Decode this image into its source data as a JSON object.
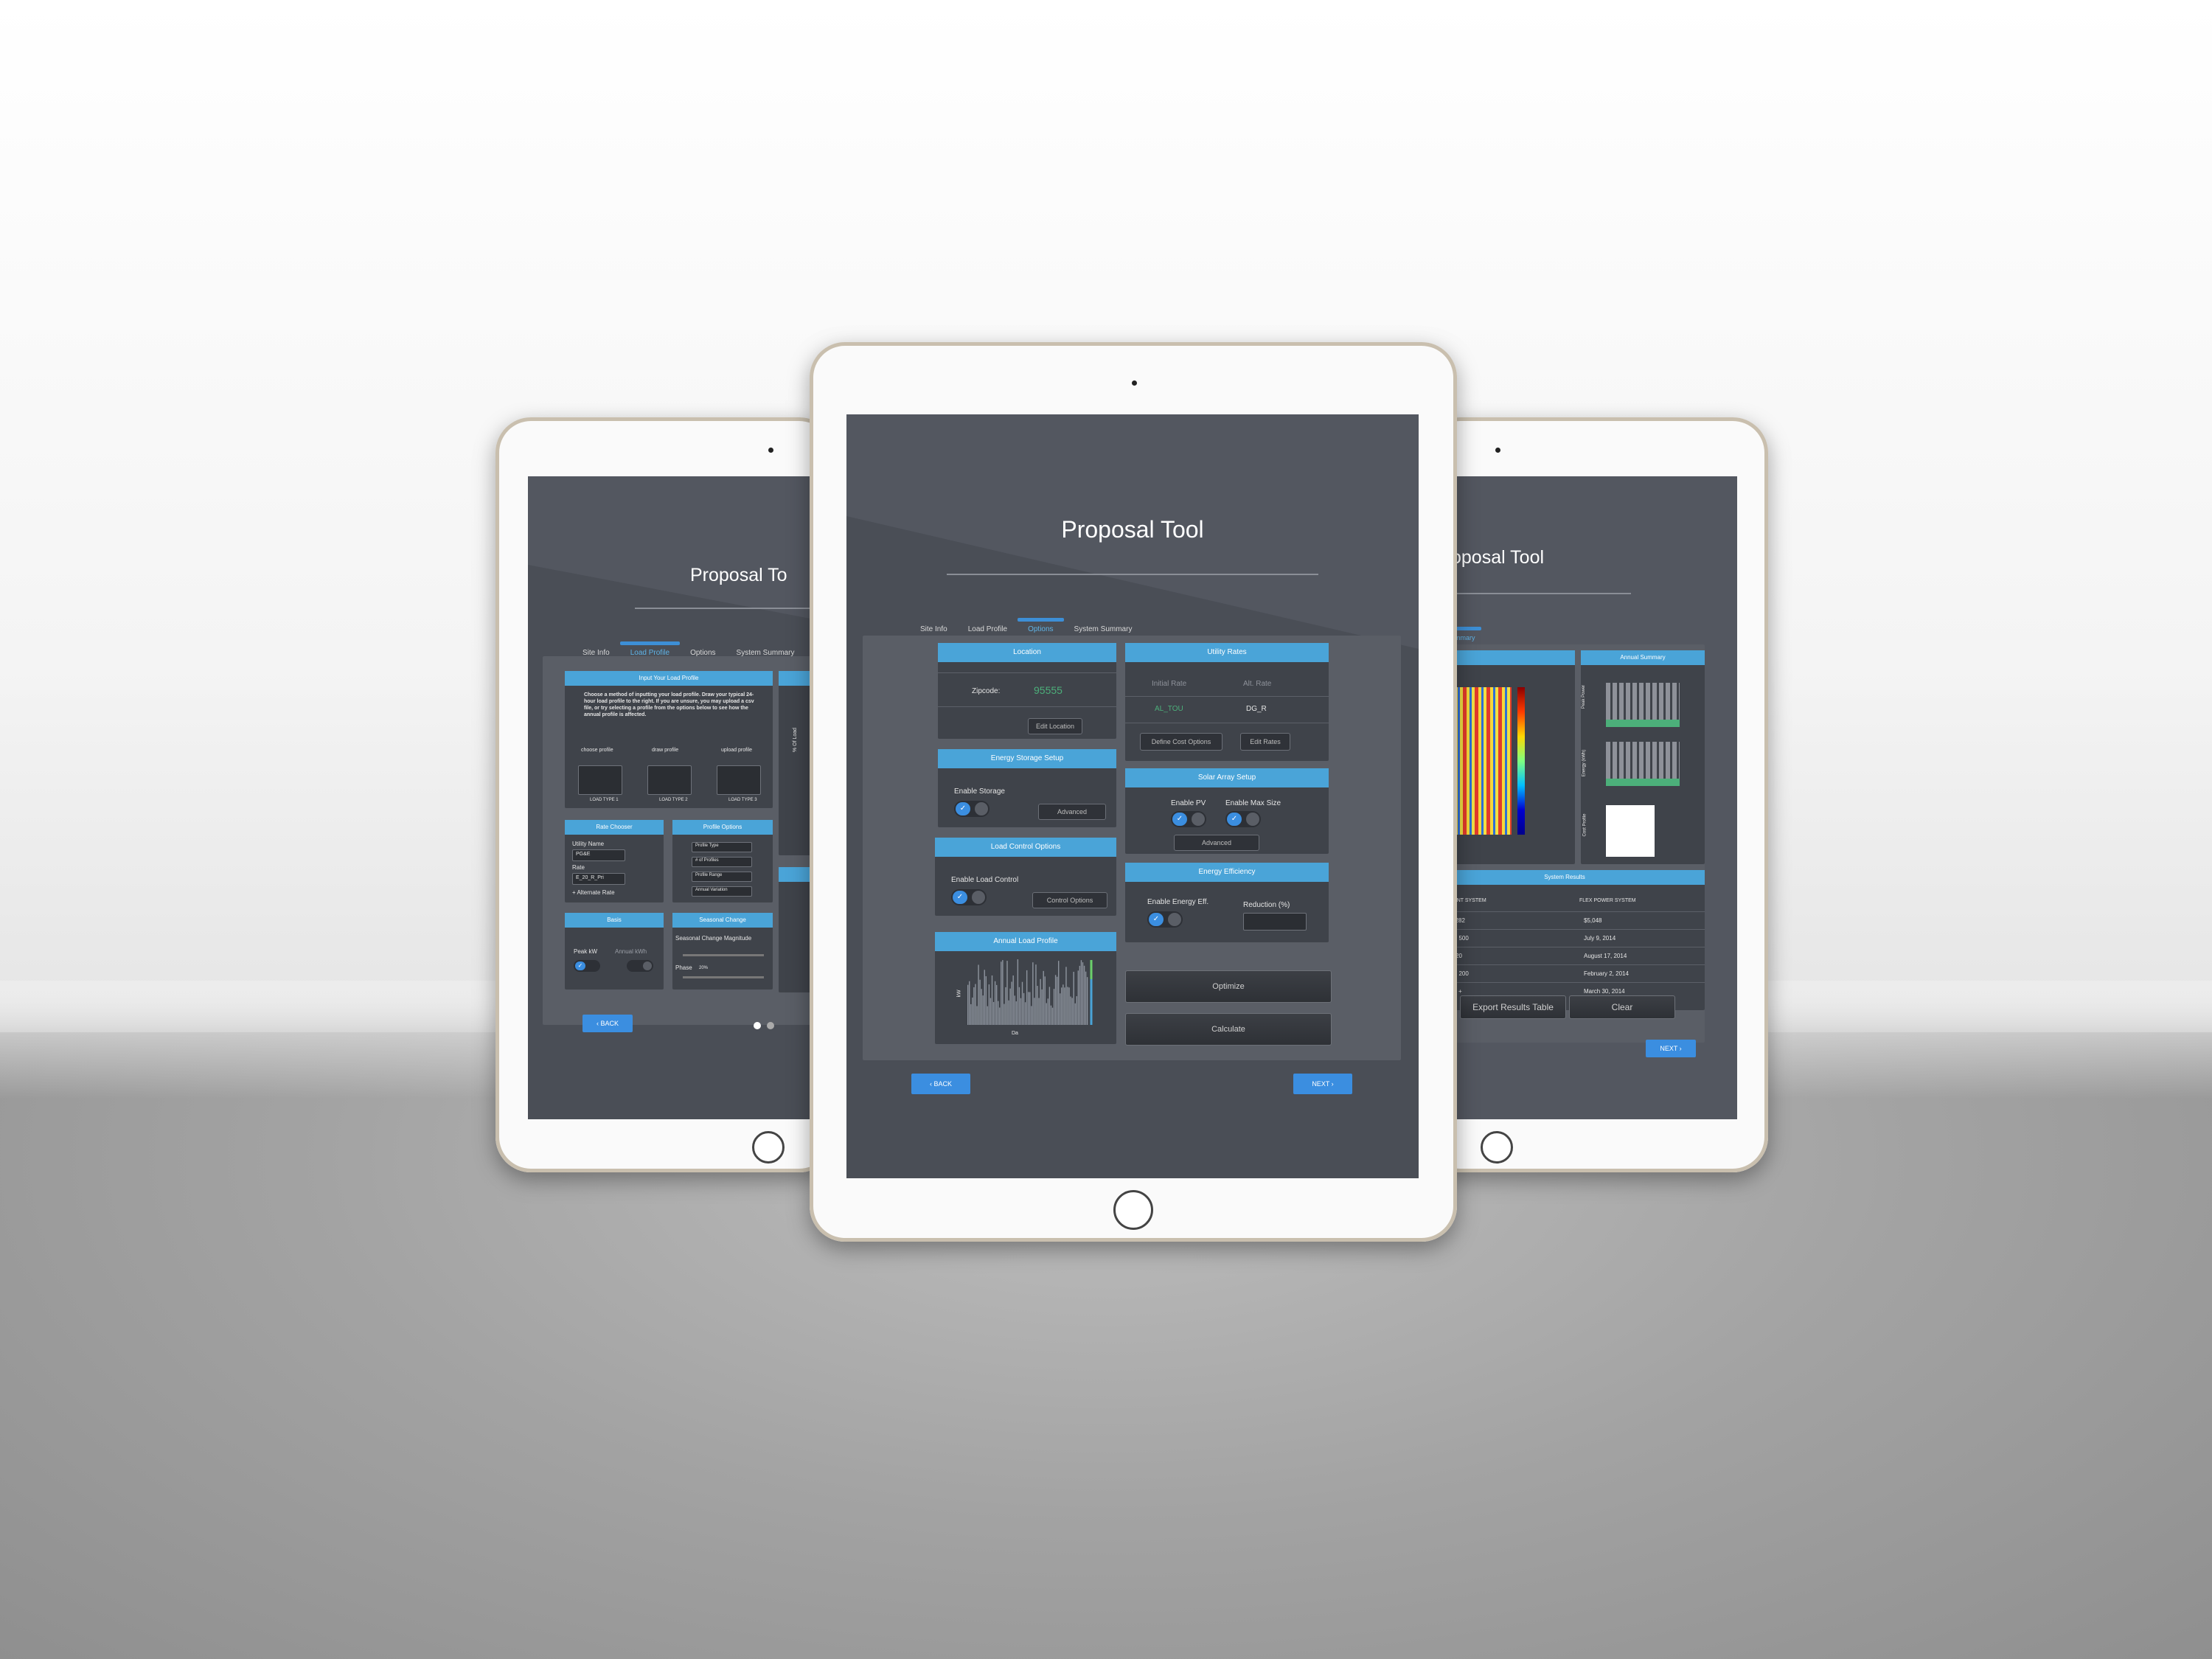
{
  "app_title": "Proposal Tool",
  "tabs": [
    "Site Info",
    "Load Profile",
    "Options",
    "System Summary"
  ],
  "active_tab_center": "Options",
  "active_tab_left": "Load Profile",
  "active_tab_right": "System Summary",
  "center": {
    "location": {
      "header": "Location",
      "zip_label": "Zipcode:",
      "zip_value": "95555",
      "edit_btn": "Edit Location"
    },
    "utility_rates": {
      "header": "Utility Rates",
      "initial_rate_label": "Initial Rate",
      "alt_rate_label": "Alt. Rate",
      "initial_rate_value": "AL_TOU",
      "alt_rate_value": "DG_R",
      "cost_btn": "Define Cost Options",
      "edit_rates_btn": "Edit Rates"
    },
    "energy_storage": {
      "header": "Energy Storage Setup",
      "enable_label": "Enable Storage",
      "advanced_btn": "Advanced"
    },
    "solar_array": {
      "header": "Solar Array Setup",
      "enable_pv": "Enable PV",
      "enable_max": "Enable Max Size",
      "advanced_btn": "Advanced"
    },
    "load_control": {
      "header": "Load Control Options",
      "enable_label": "Enable Load Control",
      "options_btn": "Control Options"
    },
    "energy_efficiency": {
      "header": "Energy Efficiency",
      "enable_label": "Enable Energy Eff.",
      "reduction_label": "Reduction (%)"
    },
    "annual_load": {
      "header": "Annual Load Profile",
      "xlabel": "Da",
      "ylabel": "kW"
    },
    "optimize_btn": "Optimize",
    "calculate_btn": "Calculate",
    "back_btn": "BACK",
    "next_btn": "NEXT"
  },
  "left": {
    "title": "Proposal To",
    "input_header": "Input Your Load Profile",
    "input_text": "Choose a method of inputting your load profile. Draw your typical 24-hour load profile to the right. If you are unsure, you may upload a csv file, or try selecting a profile from the options below to see how the annual profile is affected.",
    "methods": [
      "choose profile",
      "draw profile",
      "upload profile"
    ],
    "load_types": [
      "LOAD TYPE 1",
      "LOAD TYPE 2",
      "LOAD TYPE 3"
    ],
    "rate_header": "Rate Chooser",
    "utility_name_label": "Utility Name",
    "utility_name_value": "PG&E",
    "rate_label": "Rate",
    "rate_value": "E_20_R_Pri",
    "alt_rate_link": "+ Alternate Rate",
    "profile_header": "Profile Options",
    "profile_items": [
      "Profile Type",
      "# of Profiles",
      "Profile Range",
      "Annual Variation"
    ],
    "basis_header": "Basis",
    "peak_kw": "Peak kW",
    "annual_kwh": "Annual kWh",
    "seasonal_header": "Seasonal Change",
    "seasonal_mag": "Seasonal Change Magnitude",
    "phase": "Phase",
    "phase_val": "20%",
    "y_axis": "% Of Load",
    "back_btn": "BACK"
  },
  "right": {
    "title": "oposal Tool",
    "tab_partial": "stem Summary",
    "annual_summary_header": "Annual Summary",
    "y_energy": "Energy (kWh)",
    "y_peak": "Peak Power",
    "y_cost": "Cost Profile",
    "system_results_header": "System Results",
    "col_present": "PRESENT SYSTEM",
    "col_flex": "FLEX POWER SYSTEM",
    "rows": [
      [
        "$30,282",
        "$5,048"
      ],
      [
        "200 - 500",
        "July 9, 2014"
      ],
      [
        "10 - 20",
        "August 17, 2014"
      ],
      [
        "100 - 200",
        "February 2, 2014"
      ],
      [
        "1000 +",
        "March 30, 2014"
      ]
    ],
    "btn_partial": "stem",
    "export_btn": "Export Results Table",
    "clear_btn": "Clear",
    "next_btn": "NEXT"
  },
  "colors": {
    "accent": "#4aa4d8",
    "nav_button": "#3b8ee0",
    "screen": "#535760",
    "panel": "#3f434a",
    "zip_green": "#4caf7a"
  }
}
